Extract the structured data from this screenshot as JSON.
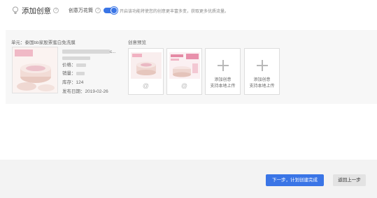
{
  "header": {
    "title": "添加创意",
    "help_glyph": "?",
    "toggle_label": "创意万花筒",
    "toggle_on": true,
    "toggle_desc": "开启该功能将使您的创意更丰富多变，获取更多优质流量。"
  },
  "unit": {
    "label": "单元：泰国bb家股票蜜白免洗膜",
    "product_name": "c...",
    "price_label": "价格：",
    "price_value": "",
    "sales_label": "销量：",
    "stock_label": "库存：",
    "stock_value": "124",
    "publish_label": "发布日期：",
    "publish_date": "2019-02-26"
  },
  "preview": {
    "label": "创意预览",
    "cards": [
      {
        "at": "@"
      },
      {
        "at": "@"
      }
    ],
    "add_cards": [
      {
        "line1": "添加创意",
        "line2": "支持本地上传"
      },
      {
        "line1": "添加创意",
        "line2": "支持本地上传"
      }
    ]
  },
  "footer": {
    "next_label": "下一步，计划创建完成",
    "back_label": "返回上一步"
  },
  "colors": {
    "accent": "#3a75e6",
    "panel_bg": "#f7f7f7",
    "footer_bg": "#f3f3f3"
  }
}
